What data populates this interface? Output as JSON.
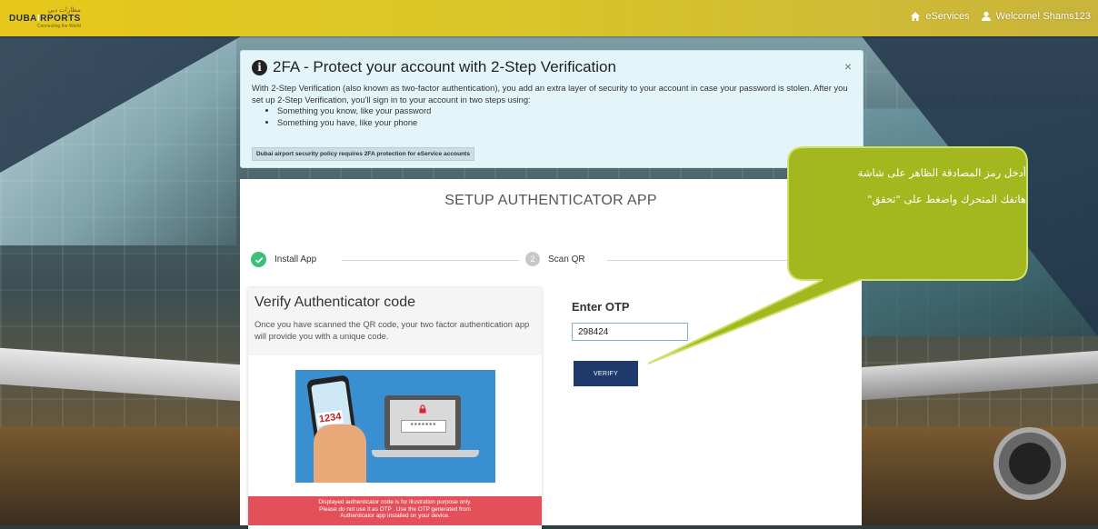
{
  "header": {
    "logo_arabic": "مطارات دبي",
    "logo_main_part1": "DUBA",
    "logo_main_part2": "I",
    "logo_main_part3": "RPORTS",
    "logo_tagline": "Connecting the World",
    "eservices_label": "eServices",
    "welcome_label": "Welcome! Shams123"
  },
  "alert": {
    "title": "2FA - Protect your account with 2-Step Verification",
    "description": "With 2-Step Verification (also known as two-factor authentication), you add an extra layer of security to your account in case your password is stolen. After you set up 2-Step Verification, you'll sign in to your account in two steps using:",
    "bullets": [
      "Something you know, like your password",
      "Something you have, like your phone"
    ],
    "policy": "Dubai airport security policy requires 2FA protection for eService accounts",
    "close_symbol": "×"
  },
  "setup": {
    "title": "SETUP AUTHENTICATOR APP",
    "steps": [
      {
        "label": "Install App",
        "status": "done"
      },
      {
        "number": "2",
        "label": "Scan QR",
        "status": "pending"
      }
    ]
  },
  "verify": {
    "heading": "Verify Authenticator code",
    "description": "Once you have scanned the QR code, your two factor authentication app will provide you with a unique code.",
    "illustration_code": "1234",
    "illustration_password": "*******",
    "disclaimer_line1": "Displayed authenticator code is for illustration purpose only.",
    "disclaimer_line2": "Please do not use it as OTP . Use the OTP generated from",
    "disclaimer_line3": "Authenticator app installed on your device."
  },
  "otp": {
    "label": "Enter OTP",
    "value": "298424",
    "button_label": "VERIFY"
  },
  "callout": {
    "line1": "أدخل رمز المصادقة الظاهر على شاشة",
    "line2": "هاتفك المتحرك واضغط على \"تحقق\"",
    "fill_color": "#a3b81e",
    "border_color": "#cfe06a"
  }
}
